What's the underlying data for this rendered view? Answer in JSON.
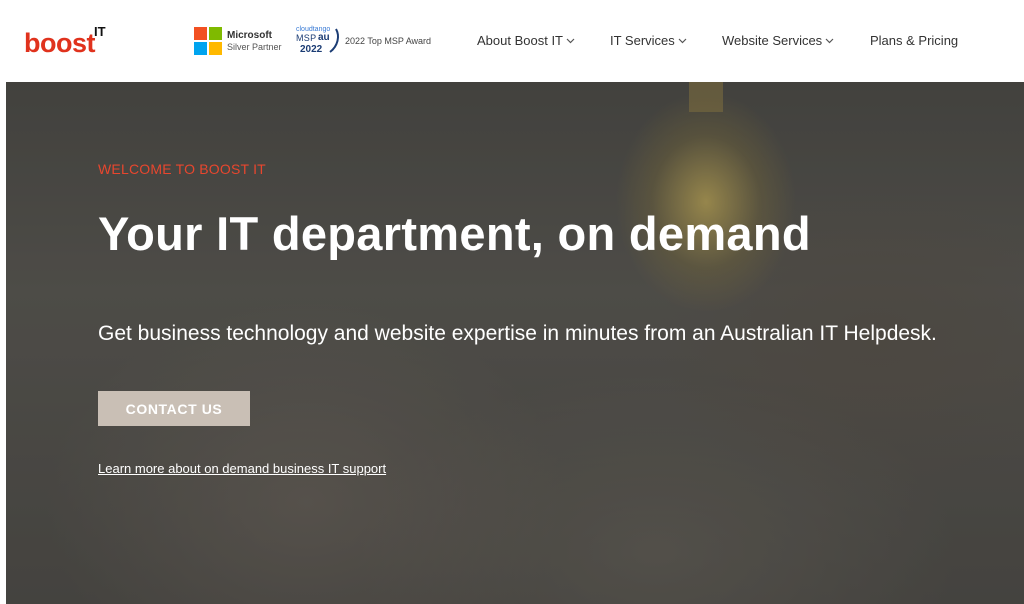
{
  "header": {
    "logo_text": "boost",
    "logo_superscript": "IT",
    "partner_badge": {
      "brand": "Microsoft",
      "level": "Silver Partner",
      "colors": [
        "#f25022",
        "#7fba00",
        "#00a4ef",
        "#ffb900"
      ]
    },
    "msp_badge": {
      "brand": "cloudtango",
      "name": "MSP",
      "region": "au",
      "select_year": "2022",
      "caption": "2022 Top MSP Award"
    },
    "nav": [
      {
        "label": "About Boost IT",
        "has_dropdown": true
      },
      {
        "label": "IT Services",
        "has_dropdown": true
      },
      {
        "label": "Website Services",
        "has_dropdown": true
      },
      {
        "label": "Plans & Pricing",
        "has_dropdown": false
      }
    ]
  },
  "hero": {
    "eyebrow": "WELCOME TO BOOST IT",
    "title": "Your IT department, on demand",
    "subtitle": "Get business technology and website expertise in minutes from an Australian IT Helpdesk.",
    "cta_label": "CONTACT US",
    "link_text": "Learn more about on demand business IT support"
  },
  "colors": {
    "brand_red": "#e0321d",
    "eyebrow_red": "#e8462e",
    "cta_bg": "#c9bfb5"
  }
}
